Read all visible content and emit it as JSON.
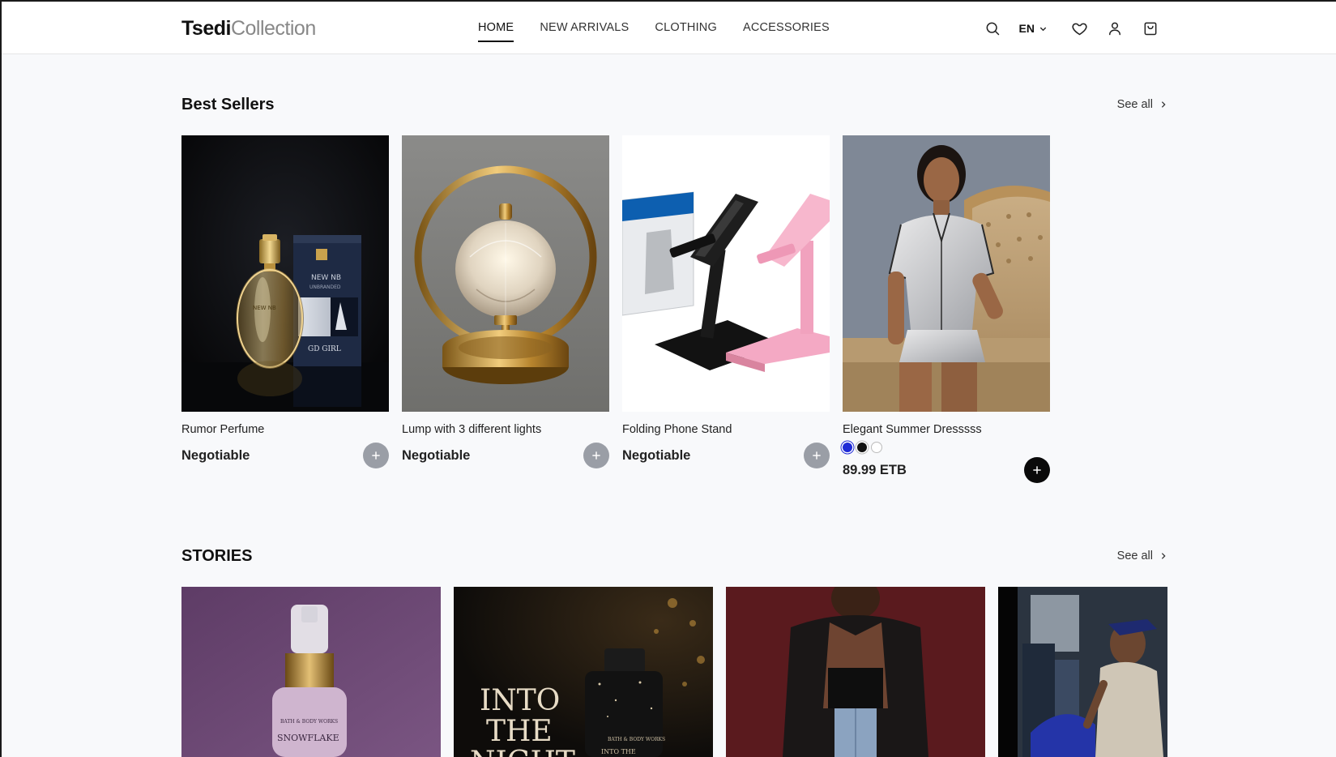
{
  "brand": {
    "bold": "Tsedi",
    "light": "Collection"
  },
  "nav": {
    "items": [
      {
        "label": "HOME",
        "active": true
      },
      {
        "label": "NEW ARRIVALS",
        "active": false
      },
      {
        "label": "CLOTHING",
        "active": false
      },
      {
        "label": "ACCESSORIES",
        "active": false
      }
    ]
  },
  "toolbar": {
    "language": "EN",
    "icons": [
      "search-icon",
      "chevron-down-icon",
      "heart-icon",
      "user-icon",
      "shopping-bag-icon"
    ]
  },
  "best_sellers": {
    "title": "Best Sellers",
    "see_all": "See all",
    "products": [
      {
        "name": "Rumor Perfume",
        "price": "Negotiable",
        "button": "grey"
      },
      {
        "name": "Lump with 3 different lights",
        "price": "Negotiable",
        "button": "grey"
      },
      {
        "name": "Folding Phone Stand",
        "price": "Negotiable",
        "button": "grey"
      },
      {
        "name": "Elegant Summer Dresssss",
        "price": "89.99 ETB",
        "button": "black",
        "colors": [
          "#1f2bd6",
          "#111111",
          "#ffffff"
        ],
        "selected_color": "#1f2bd6"
      }
    ]
  },
  "stories": {
    "title": "STORIES",
    "see_all": "See all",
    "items": [
      {
        "image_text": [
          "BATH & BODY WORKS",
          "SNOWFLAKE"
        ]
      },
      {
        "image_text": [
          "INTO",
          "THE",
          "NIGHT",
          "BATH & BODY WORKS",
          "INTO THE"
        ]
      },
      {
        "image_text": []
      },
      {
        "image_text": []
      }
    ]
  },
  "colors": {
    "accent": "#111111",
    "plus_grey": "#9a9ea6",
    "background": "#f8f9fb"
  }
}
